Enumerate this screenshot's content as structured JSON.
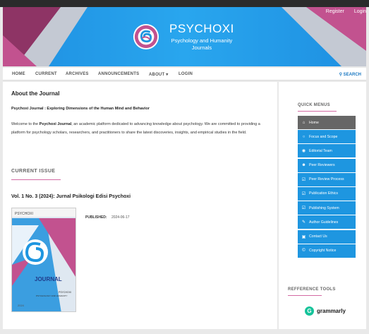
{
  "header": {
    "title": "PSYCHOXI",
    "subtitle_line1": "Psychology and Humanity",
    "subtitle_line2": "Journals",
    "user_links": [
      "Register",
      "Login"
    ]
  },
  "nav": {
    "items": [
      "HOME",
      "CURRENT",
      "ARCHIVES",
      "ANNOUNCEMENTS",
      "ABOUT ▾",
      "LOGIN"
    ],
    "search": "SEARCH"
  },
  "about": {
    "heading": "About the Journal",
    "subtitle": "Psychoxi Journal : Exploring Dimensions of the Human Mind and Behavior",
    "intro_before": "Welcome to the ",
    "intro_bold": "Psychoxi Journal",
    "intro_after": ", an academic platform dedicated to advancing knowledge about psychology. We are committed to providing a platform for psychology scholars, researchers, and practitioners to share the latest discoveries, insights, and empirical studies in the field."
  },
  "current_issue": {
    "heading": "CURRENT ISSUE",
    "issue_title": "Vol. 1 No. 3 (2024): Jurnal Psikologi Edisi Psychoxi",
    "published_label": "PUBLISHED:",
    "published_date": "2024-06-17",
    "cover_top": "PSYCHOXI",
    "cover_word": "JOURNAL",
    "cover_sub1": "PSYCHOXI",
    "cover_sub2": "PSYCHOLOGY AND HUMANITY",
    "cover_year": "2024"
  },
  "sidebar": {
    "quick_menus_heading": "QUICK MENUS",
    "menu": [
      {
        "label": "Home",
        "icon": "home-icon",
        "active": true
      },
      {
        "label": "Focus and Scope",
        "icon": "circle-icon"
      },
      {
        "label": "Editorial Team",
        "icon": "user-circle-icon"
      },
      {
        "label": "Peer Reviewers",
        "icon": "users-icon"
      },
      {
        "label": "Peer Review Process",
        "icon": "check-square-icon"
      },
      {
        "label": "Publication Ethics",
        "icon": "check-square-icon"
      },
      {
        "label": "Publishing System",
        "icon": "check-square-icon"
      },
      {
        "label": "Author Guidelines",
        "icon": "edit-icon"
      },
      {
        "label": "Contact Us",
        "icon": "address-card-icon"
      },
      {
        "label": "Copyright Notice",
        "icon": "copyright-icon"
      }
    ],
    "tools_heading": "REFFERENCE TOOLS",
    "grammarly": "grammarly"
  },
  "colors": {
    "header_blue": "#1e96e0",
    "accent_pink": "#d36aa3",
    "menu_blue": "#1e96e0",
    "menu_active": "#666666"
  }
}
